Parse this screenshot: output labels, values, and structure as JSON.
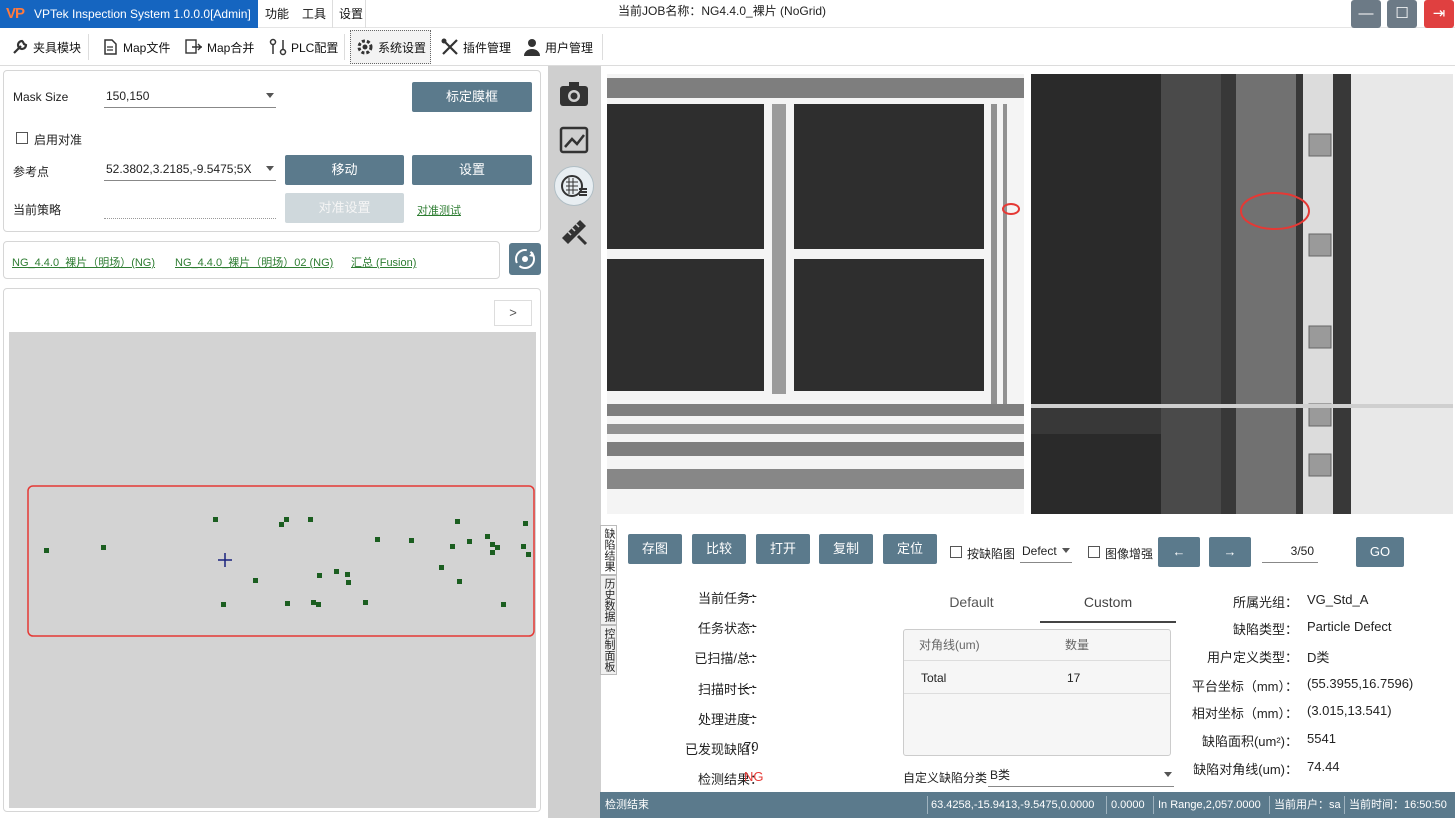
{
  "titlebar": {
    "app_title": "VPTek Inspection System 1.0.0.0[Admin]",
    "logo_text": "VP",
    "menus": [
      "功能",
      "工具",
      "设置"
    ],
    "job_title": "当前JOB名称：NG4.4.0_裸片 (NoGrid)",
    "window_buttons": {
      "minimize": "—",
      "maximize": "☐",
      "close": "⇥"
    }
  },
  "toolbar": {
    "items": [
      {
        "label": "夹具模块",
        "icon": "wrench-icon"
      },
      {
        "label": "Map文件",
        "icon": "document-icon"
      },
      {
        "label": "Map合并",
        "icon": "merge-icon"
      },
      {
        "label": "PLC配置",
        "icon": "plc-icon"
      },
      {
        "label": "系统设置",
        "icon": "gear-icon"
      },
      {
        "label": "插件管理",
        "icon": "tools-icon"
      },
      {
        "label": "用户管理",
        "icon": "user-icon"
      }
    ]
  },
  "settings": {
    "mask_size_label": "Mask Size",
    "mask_size_value": "150,150",
    "calibrate_button": "标定膜框",
    "enable_align_label": "启用对准",
    "ref_point_label": "参考点",
    "ref_point_value": "52.3802,3.2185,-9.5475;5X",
    "move_button": "移动",
    "set_button": "设置",
    "strategy_label": "当前策略",
    "strategy_value": "",
    "align_settings_button": "对准设置",
    "align_test_link": "对准测试"
  },
  "result_tabs": [
    "NG_4.4.0_裸片（明场）(NG)",
    "NG_4.4.0_裸片（明场）02 (NG)",
    "汇总 (Fusion)"
  ],
  "map": {
    "next_button": ">"
  },
  "actions": {
    "save_image": "存图",
    "compare": "比较",
    "open": "打开",
    "copy": "复制",
    "locate": "定位",
    "by_defect_label": "按缺陷图",
    "defect_select": "Defect",
    "enhance_label": "图像增强",
    "prev": "←",
    "next": "→",
    "page": "3/50",
    "go": "GO"
  },
  "side_tabs": [
    "缺陷结果",
    "历史数据",
    "控制面板"
  ],
  "task_info": [
    {
      "label": "当前任务：",
      "value": "---"
    },
    {
      "label": "任务状态：",
      "value": "---"
    },
    {
      "label": "已扫描/总：",
      "value": "---"
    },
    {
      "label": "扫描时长：",
      "value": "---"
    },
    {
      "label": "处理进度：",
      "value": "---"
    },
    {
      "label": "已发现缺陷：",
      "value": "70"
    },
    {
      "label": "检测结果：",
      "value": "NG"
    }
  ],
  "result_color": "#e53935",
  "table": {
    "tabs": [
      "Default",
      "Custom"
    ],
    "headers": [
      "对角线(um)",
      "数量"
    ],
    "rows": [
      {
        "name": "Total",
        "count": "17"
      }
    ]
  },
  "custom_defect_class": {
    "label": "自定义缺陷分类",
    "value": "B类"
  },
  "defect_info": [
    {
      "label": "所属光组：",
      "value": "VG_Std_A"
    },
    {
      "label": "缺陷类型：",
      "value": "Particle Defect"
    },
    {
      "label": "用户定义类型：",
      "value": "D类"
    },
    {
      "label": "平台坐标（mm）：",
      "value": "(55.3955,16.7596)"
    },
    {
      "label": "相对坐标（mm）：",
      "value": "(3.015,13.541)"
    },
    {
      "label": "缺陷面积(um²)：",
      "value": "5541"
    },
    {
      "label": "缺陷对角线(um)：",
      "value": "74.44"
    }
  ],
  "statusbar": {
    "status": "检测结束",
    "coords": "63.4258,-15.9413,-9.5475,0.0000",
    "value": "0.0000",
    "range": "In Range,2,057.0000",
    "user": "当前用户：sa",
    "time": "当前时间：16:50:50"
  },
  "colors": {
    "accent": "#1565c0",
    "button": "#5b7a8c",
    "map_bg": "#d3d3d3",
    "marker": "#1b5e20",
    "selection": "#e53935"
  }
}
